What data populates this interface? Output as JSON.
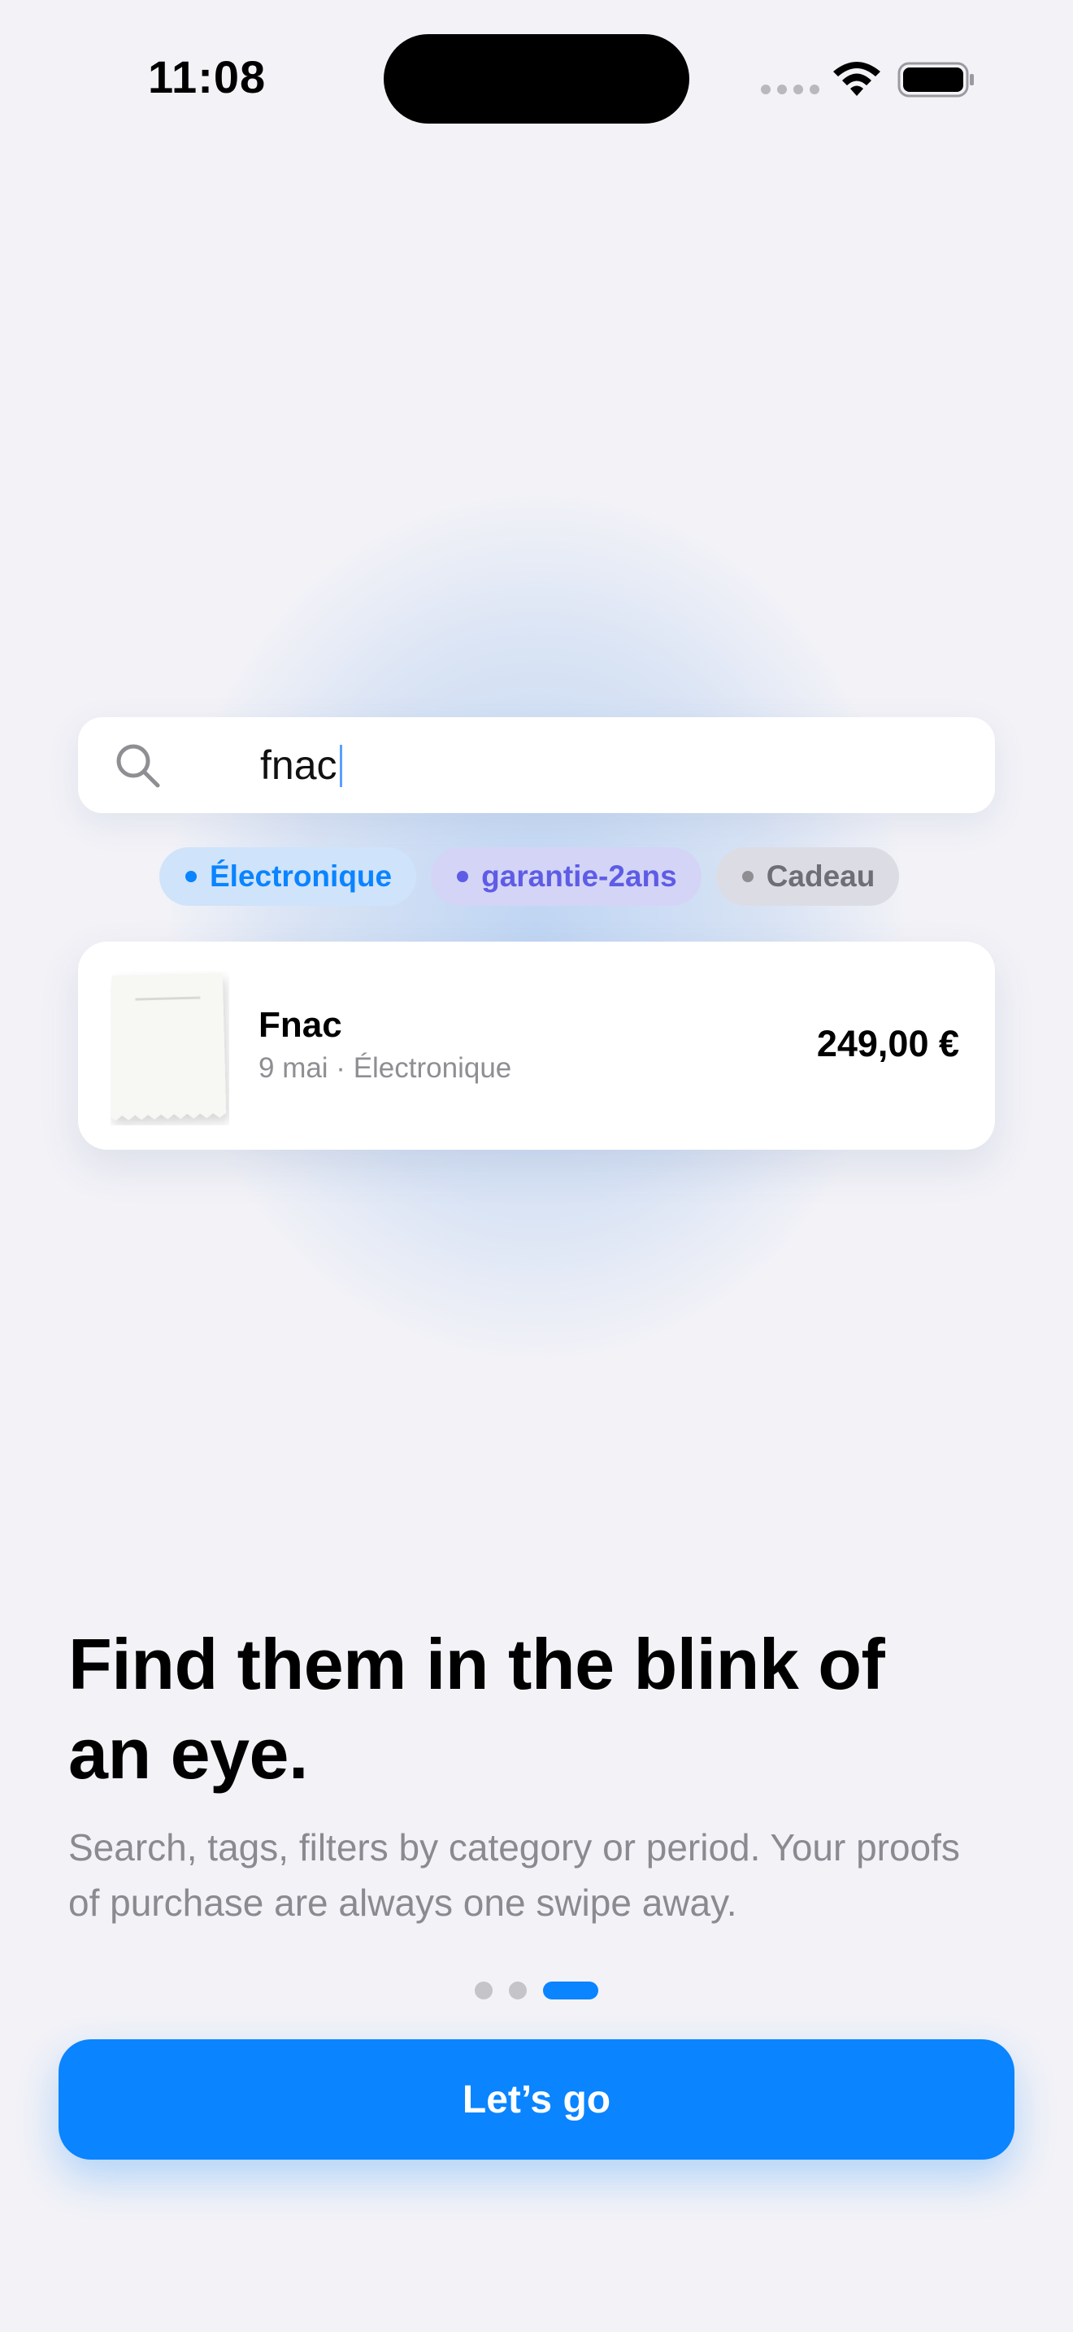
{
  "status_bar": {
    "time": "11:08"
  },
  "search": {
    "query": "fnac"
  },
  "tags": [
    {
      "label": "Électronique",
      "color": "#0a84ff"
    },
    {
      "label": "garantie-2ans",
      "color": "#5e5ce6"
    },
    {
      "label": "Cadeau",
      "color": "#8e8e93"
    }
  ],
  "result": {
    "merchant": "Fnac",
    "subtitle": "9 mai · Électronique",
    "price": "249,00 €"
  },
  "onboarding": {
    "headline": "Find them in the blink of an eye.",
    "body": "Search, tags, filters by category or period. Your proofs of purchase are always one swipe away.",
    "pages_total": 3,
    "current_page": 3
  },
  "cta": {
    "label": "Let’s go"
  },
  "colors": {
    "accent": "#0a84ff",
    "background": "#f2f2f7"
  }
}
